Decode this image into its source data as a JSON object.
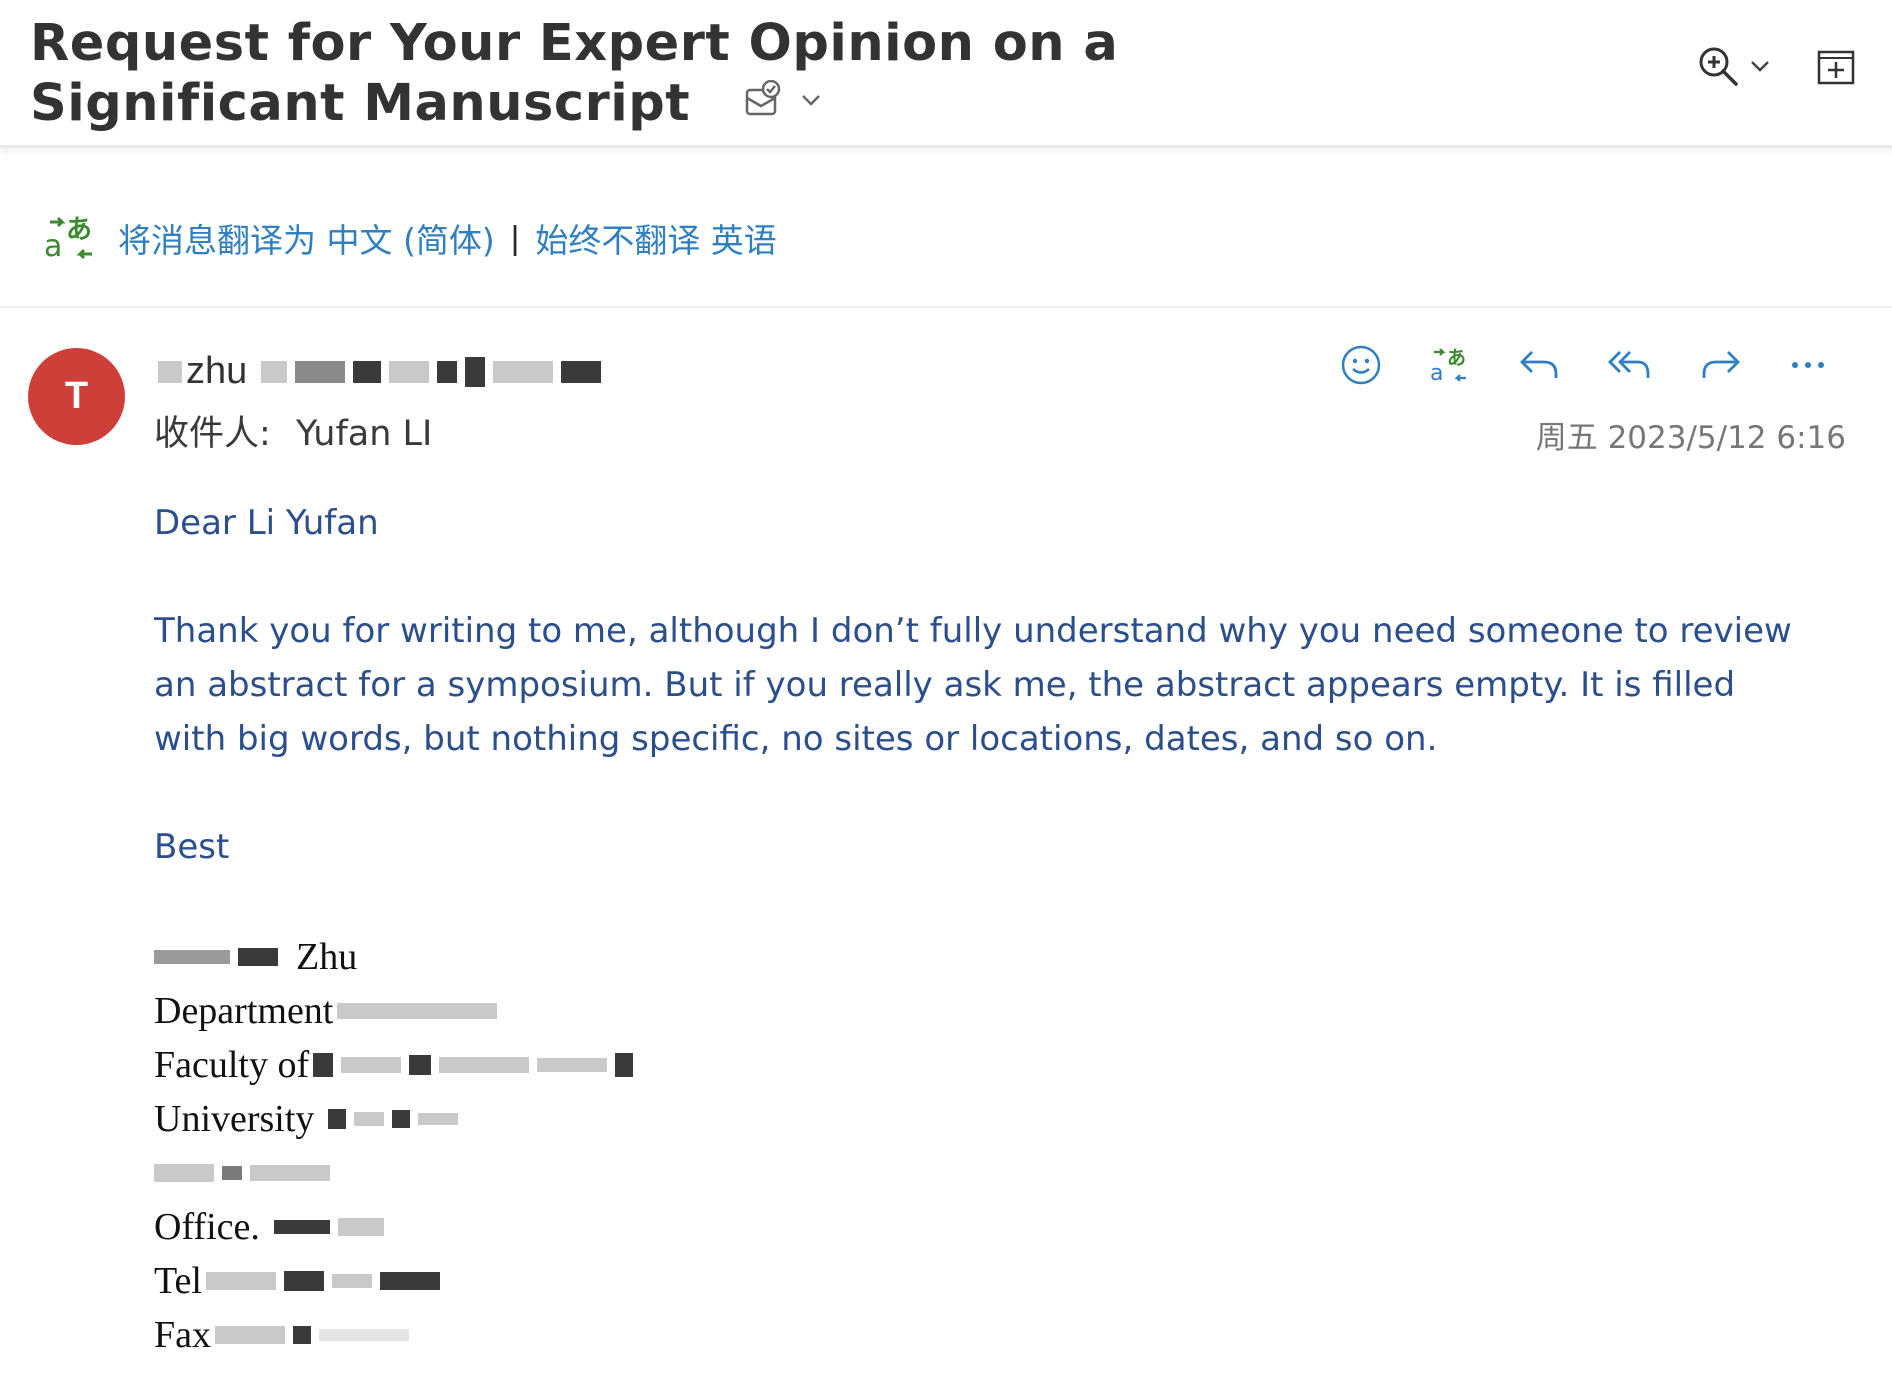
{
  "header": {
    "subject": "Request for Your Expert Opinion on a Significant Manuscript"
  },
  "translation_bar": {
    "translate_prompt": "将消息翻译为 中文 (简体)",
    "separator": "|",
    "never_translate": "始终不翻译 英语"
  },
  "message": {
    "avatar_initial": "T",
    "sender_name": "zhu",
    "to_label": "收件人:",
    "recipient": "Yufan LI",
    "date": "周五 2023/5/12 6:16",
    "greeting": "Dear Li Yufan",
    "paragraph": "Thank you for writing to me, although I don’t fully understand why you need someone to review an abstract for a symposium. But if you really ask me, the abstract appears empty. It is filled with big words, but nothing specific, no sites or locations, dates, and so on.",
    "closing": "Best"
  },
  "signature": {
    "name_tail": "Zhu",
    "department": "Department",
    "faculty": "Faculty of",
    "university": "University",
    "office": "Office.",
    "tel": "Tel",
    "fax": "Fax"
  },
  "icons": {
    "zoom": "zoom-in-icon",
    "expand": "open-in-window-icon",
    "emoji": "smiley-icon",
    "translate": "translate-icon",
    "reply": "reply-icon",
    "reply_all": "reply-all-icon",
    "forward": "forward-icon",
    "more": "more-icon"
  },
  "colors": {
    "accent_blue": "#2f7fc1",
    "body_text": "#2b4e8c",
    "avatar": "#cf3f3a",
    "translate_green": "#3a8a2e"
  }
}
